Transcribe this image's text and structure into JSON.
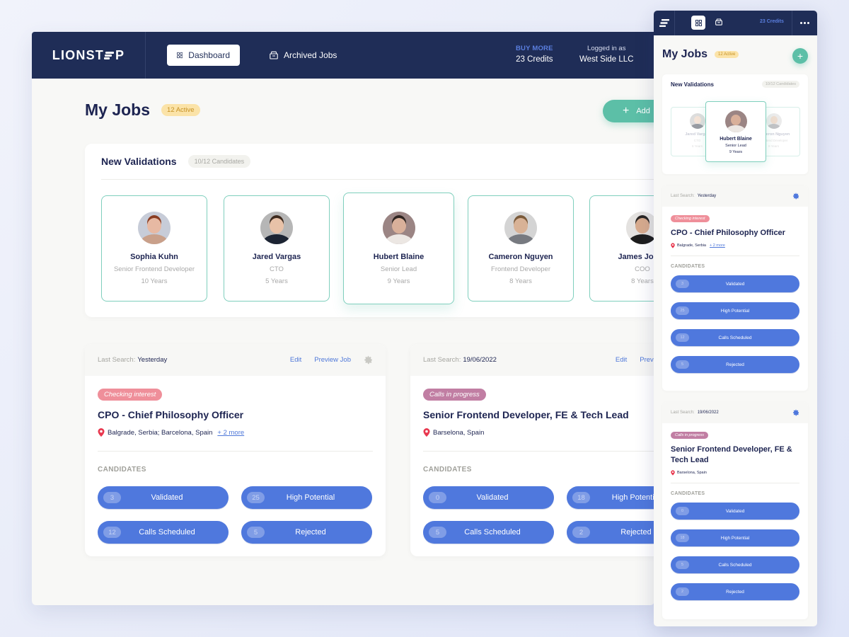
{
  "brand": {
    "logo_pre": "LIONST",
    "logo_post": "P"
  },
  "nav": {
    "dashboard": "Dashboard",
    "archived": "Archived Jobs"
  },
  "credits": {
    "buy_more": "BUY MORE",
    "amount": "23 Credits"
  },
  "account": {
    "label": "Logged in as",
    "name": "West Side LLC"
  },
  "page": {
    "title": "My Jobs",
    "active_badge": "12 Active",
    "add_label": "Add"
  },
  "validations": {
    "title": "New Validations",
    "count": "10/12 Candidates",
    "candidates": [
      {
        "name": "Sophia Kuhn",
        "role": "Senior Frontend Developer",
        "years": "10 Years",
        "skin": "#e7b9a3",
        "hair": "#8a3d22",
        "shirt": "#c9a08a",
        "bg": "#c7ccd8"
      },
      {
        "name": "Jared Vargas",
        "role": "CTO",
        "years": "5 Years",
        "skin": "#e8c2a8",
        "hair": "#3d2a1e",
        "shirt": "#1c2433",
        "bg": "#b6b6b6"
      },
      {
        "name": "Hubert Blaine",
        "role": "Senior Lead",
        "years": "9 Years",
        "skin": "#d9b09a",
        "hair": "#2e2420",
        "shirt": "#ece7e3",
        "bg": "#9b8584"
      },
      {
        "name": "Cameron Nguyen",
        "role": "Frontend Developer",
        "years": "8 Years",
        "skin": "#d8b296",
        "hair": "#7a5a3a",
        "shirt": "#777a80",
        "bg": "#d4d4d4"
      },
      {
        "name": "James Jones",
        "role": "COO",
        "years": "8 Years",
        "skin": "#d7ab8e",
        "hair": "#2a2624",
        "shirt": "#1d1d1d",
        "bg": "#e4e2e0"
      }
    ]
  },
  "jobs": [
    {
      "last_search_label": "Last Search:",
      "last_search": "Yesterday",
      "edit": "Edit",
      "preview": "Preview Job",
      "status": "Checking interest",
      "status_color": "#ef8f9a",
      "title": "CPO - Chief Philosophy Officer",
      "location": "Balgrade, Serbia; Barcelona, Spain",
      "location_short": "Balgrade, Serbia",
      "more": "+ 2 more",
      "candidates_label": "CANDIDATES",
      "stats": [
        {
          "count": "3",
          "label": "Validated"
        },
        {
          "count": "25",
          "label": "High Potential"
        },
        {
          "count": "12",
          "label": "Calls Scheduled"
        },
        {
          "count": "5",
          "label": "Rejected"
        }
      ]
    },
    {
      "last_search_label": "Last Search:",
      "last_search": "19/06/2022",
      "edit": "Edit",
      "preview": "Preview Job",
      "status": "Calls in progress",
      "status_color": "#c17ea3",
      "title": "Senior Frontend Developer, FE & Tech Lead",
      "location": "Barselona, Spain",
      "location_short": "Barselona, Spain",
      "more": "",
      "candidates_label": "CANDIDATES",
      "stats": [
        {
          "count": "0",
          "label": "Validated"
        },
        {
          "count": "18",
          "label": "High Potential"
        },
        {
          "count": "5",
          "label": "Calls Scheduled"
        },
        {
          "count": "2",
          "label": "Rejected"
        }
      ]
    }
  ],
  "mobile": {
    "credits": "23 Credits",
    "title": "My Jobs",
    "active_badge": "12 Active",
    "validations_title": "New Validations",
    "validations_count": "10/12 Candidates",
    "left_card": {
      "name": "Jared Vargas",
      "role": "CTO",
      "years": "5 Years"
    },
    "front_card": {
      "name": "Hubert Blaine",
      "role": "Senior Lead",
      "years": "9 Years"
    },
    "right_card": {
      "name": "Cameron Nguyen",
      "role": "Frontend Developer",
      "years": "8 Years"
    }
  },
  "colors": {
    "navy": "#1f2d57",
    "accent_blue": "#4f78dd",
    "teal": "#5cbfa7",
    "badge_yellow": "#fbe3a8"
  }
}
